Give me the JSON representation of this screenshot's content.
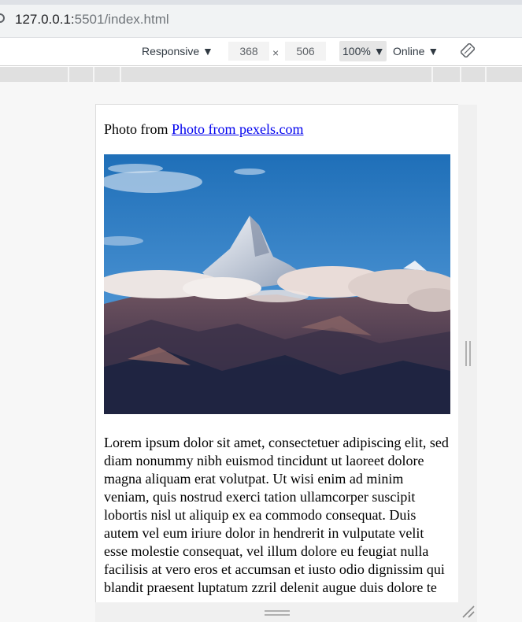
{
  "browser": {
    "url_host": "127.0.0.1:",
    "url_path": "5501/index.html"
  },
  "device_toolbar": {
    "mode": "Responsive ▼",
    "width": "368",
    "times": "×",
    "height": "506",
    "zoom": "100% ▼",
    "network": "Online ▼"
  },
  "page": {
    "credit_prefix": "Photo from",
    "credit_link": "Photo from pexels.com",
    "photo_alt": "Mountain peak above clouds",
    "paragraph": "Lorem ipsum dolor sit amet, consectetuer adipiscing elit, sed diam nonummy nibh euismod tincidunt ut laoreet dolore magna aliquam erat volutpat. Ut wisi enim ad minim veniam, quis nostrud exerci tation ullamcorper suscipit lobortis nisl ut aliquip ex ea commodo consequat. Duis autem vel eum iriure dolor in hendrerit in vulputate velit esse molestie consequat, vel illum dolore eu feugiat nulla facilisis at vero eros et accumsan et iusto odio dignissim qui blandit praesent luptatum zzril delenit augue duis dolore te"
  },
  "colors": {
    "link": "#0000ee",
    "sky_top": "#2f7fc4",
    "mountain": "#5a4050"
  },
  "icons": [
    "info-icon",
    "rotate-icon",
    "resize-grip-icon"
  ]
}
